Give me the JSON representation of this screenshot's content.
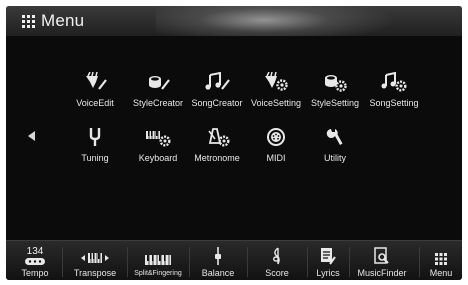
{
  "header": {
    "title": "Menu",
    "icon": "grid-icon"
  },
  "menu_items": [
    {
      "label": "VoiceEdit",
      "icon": "voice-edit-icon"
    },
    {
      "label": "StyleCreator",
      "icon": "style-creator-icon"
    },
    {
      "label": "SongCreator",
      "icon": "song-creator-icon"
    },
    {
      "label": "VoiceSetting",
      "icon": "voice-setting-icon"
    },
    {
      "label": "StyleSetting",
      "icon": "style-setting-icon"
    },
    {
      "label": "SongSetting",
      "icon": "song-setting-icon"
    },
    {
      "label": "Tuning",
      "icon": "tuning-fork-icon"
    },
    {
      "label": "Keyboard",
      "icon": "keyboard-setting-icon"
    },
    {
      "label": "Metronome",
      "icon": "metronome-icon"
    },
    {
      "label": "MIDI",
      "icon": "midi-icon"
    },
    {
      "label": "Utility",
      "icon": "wrench-icon"
    }
  ],
  "bottom_bar": {
    "tempo_value": "134",
    "items": [
      {
        "label": "Tempo",
        "icon": "tempo-icon"
      },
      {
        "label": "Transpose",
        "icon": "transpose-icon"
      },
      {
        "label": "Split&Fingering",
        "icon": "split-fingering-icon"
      },
      {
        "label": "Balance",
        "icon": "balance-icon"
      },
      {
        "label": "Score",
        "icon": "score-icon"
      },
      {
        "label": "Lyrics",
        "icon": "lyrics-icon"
      },
      {
        "label": "MusicFinder",
        "icon": "music-finder-icon"
      },
      {
        "label": "Menu",
        "icon": "menu-grid-icon"
      }
    ]
  },
  "colors": {
    "background": "#0b0b0b",
    "text": "#e8e8e8",
    "header": "#2a2a2a"
  }
}
